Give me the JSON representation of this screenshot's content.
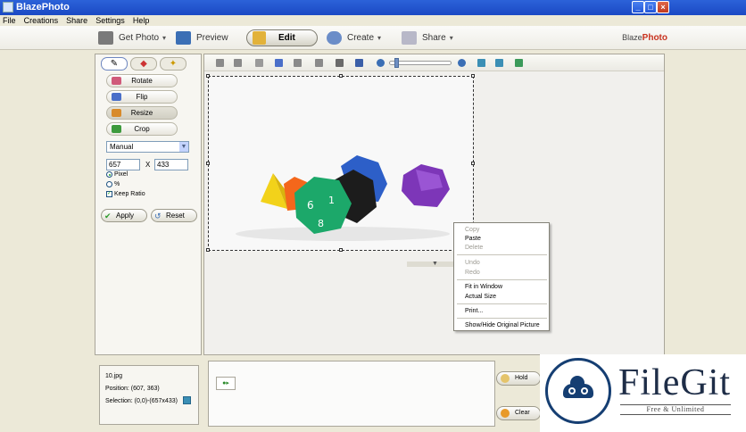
{
  "window": {
    "title": "BlazePhoto"
  },
  "menu": [
    "File",
    "Creations",
    "Share",
    "Settings",
    "Help"
  ],
  "mainbar": {
    "get_photo": "Get Photo",
    "preview": "Preview",
    "edit": "Edit",
    "create": "Create",
    "share": "Share",
    "brand_prefix": "Blaze",
    "brand_suffix": "Photo"
  },
  "tools": {
    "rotate": "Rotate",
    "flip": "Flip",
    "resize": "Resize",
    "crop": "Crop",
    "mode": "Manual",
    "width": "657",
    "x_label": "X",
    "height": "433",
    "opt_pixel": "Pixel",
    "opt_percent": "%",
    "keep_ratio": "Keep Ratio",
    "apply": "Apply",
    "reset": "Reset"
  },
  "context_menu": {
    "copy": "Copy",
    "paste": "Paste",
    "delete": "Delete",
    "undo": "Undo",
    "redo": "Redo",
    "fit": "Fit in Window",
    "actual": "Actual Size",
    "print": "Print...",
    "showhide": "Show/Hide Original Picture"
  },
  "info": {
    "file": "10.jpg",
    "position": "Position: (607, 363)",
    "selection": "Selection: (0,0)-(657x433)"
  },
  "side_buttons": {
    "hold": "Hold",
    "clear": "Clear"
  },
  "watermark": {
    "name": "FileGit",
    "tagline": "Free & Unlimited"
  },
  "colors": {
    "titlebar": "#1b49c4",
    "brand_accent": "#c8321e",
    "filegit_navy": "#153e72"
  }
}
